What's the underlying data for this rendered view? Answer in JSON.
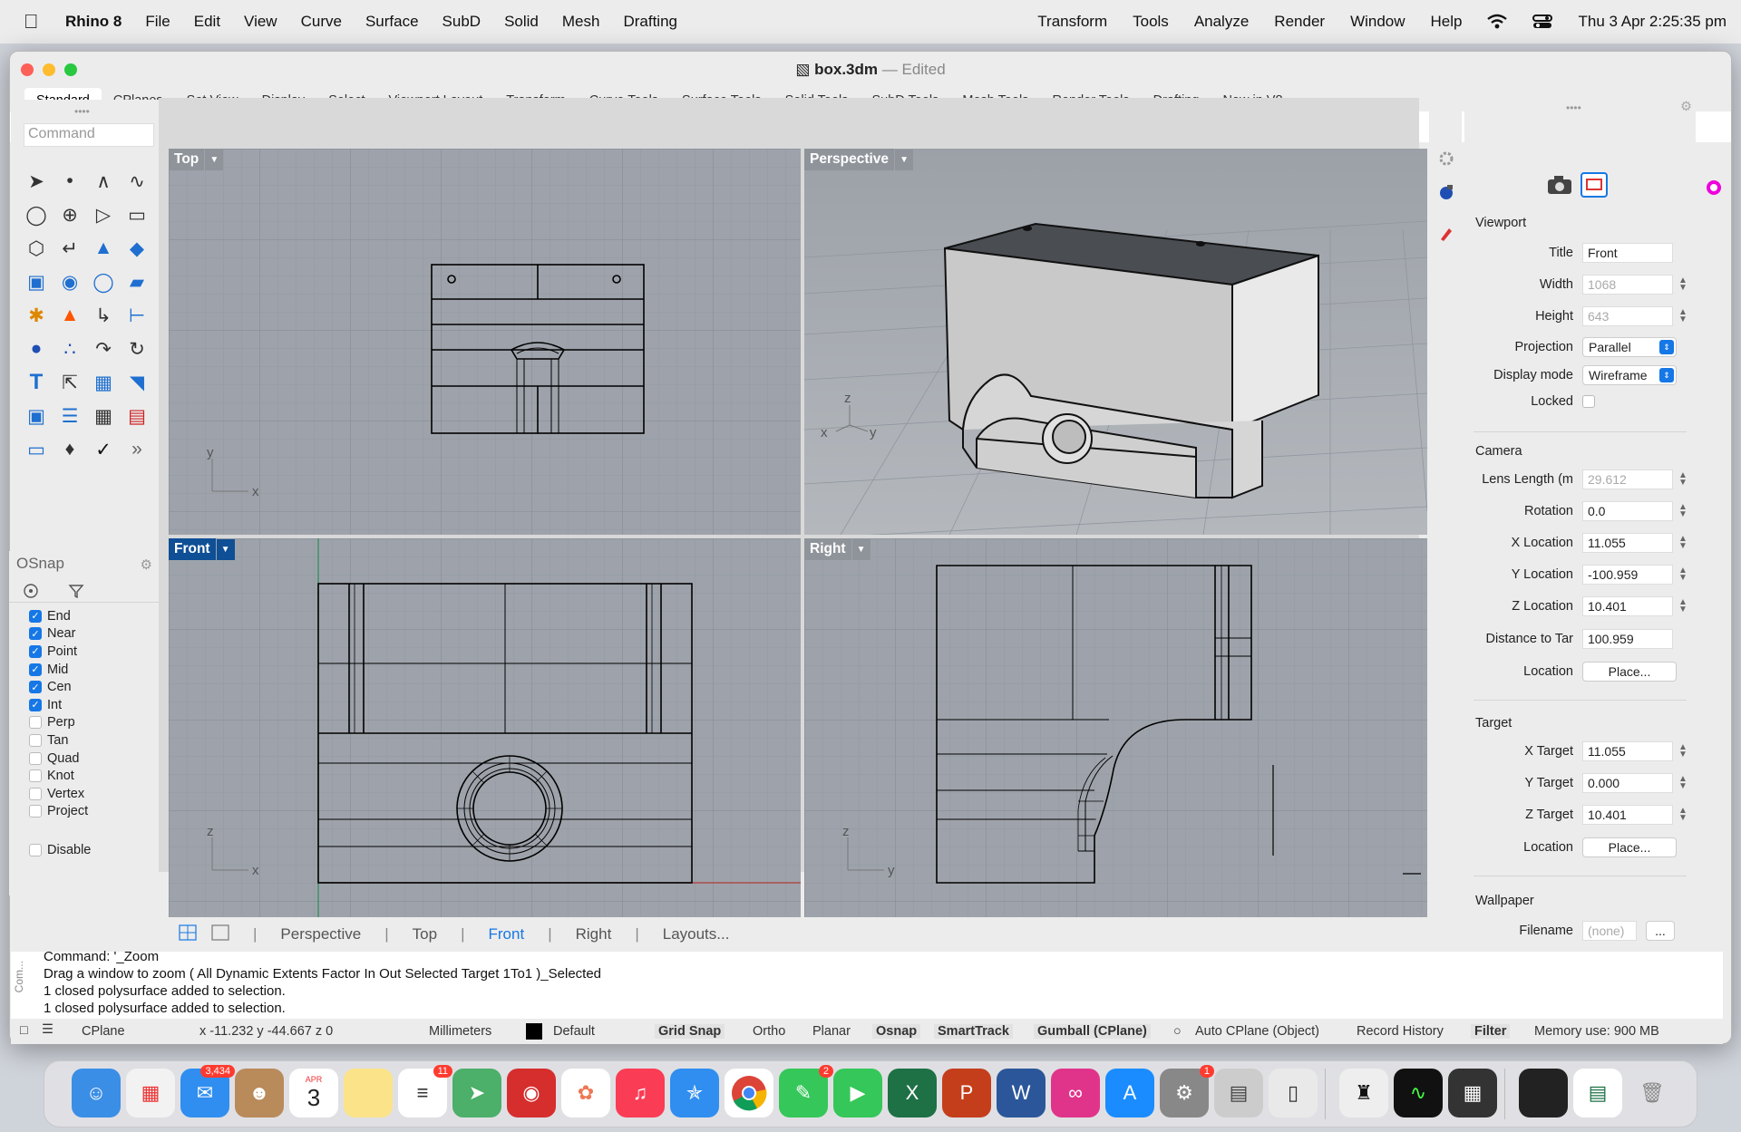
{
  "menubar": {
    "app": "Rhino 8",
    "items": [
      "File",
      "Edit",
      "View",
      "Curve",
      "Surface",
      "SubD",
      "Solid",
      "Mesh",
      "Drafting"
    ],
    "right_items": [
      "Transform",
      "Tools",
      "Analyze",
      "Render",
      "Window",
      "Help"
    ],
    "clock": "Thu 3 Apr  2:25:35 pm"
  },
  "window": {
    "filename": "box.3dm",
    "separator": "—",
    "status": "Edited"
  },
  "tabs": [
    "Standard",
    "CPlanes",
    "Set View",
    "Display",
    "Select",
    "Viewport Layout",
    "Transform",
    "Curve Tools",
    "Surface Tools",
    "Solid Tools",
    "SubD Tools",
    "Mesh Tools",
    "Render Tools",
    "Drafting",
    "New in V8"
  ],
  "toolbar_icons": [
    "new-file-icon",
    "open-file-icon",
    "save-icon",
    "print-icon",
    "import-icon",
    "cut-icon",
    "copy-icon",
    "paste-icon",
    "undo-icon",
    "pan-hand-icon",
    "rotate-view-icon",
    "zoom-icon",
    "zoom-window-icon",
    "zoom-extents-icon",
    "zoom-selected-icon",
    "rotate-icon",
    "four-viewports-icon",
    "car-icon",
    "grid-icon",
    "cplane-icon",
    "gumball-icon",
    "lightbulb-icon",
    "lock-icon",
    "layer-icon",
    "color-wheel-icon",
    "shaded-sphere-icon",
    "wireframe-sphere-icon",
    "render-sphere-icon",
    "pencil-icon",
    "gear-icon",
    "diagram-icon",
    "globe-icon",
    "help-icon"
  ],
  "command": {
    "placeholder": "Command"
  },
  "osnap": {
    "title": "OSnap",
    "items": [
      {
        "label": "End",
        "checked": true
      },
      {
        "label": "Near",
        "checked": true
      },
      {
        "label": "Point",
        "checked": true
      },
      {
        "label": "Mid",
        "checked": true
      },
      {
        "label": "Cen",
        "checked": true
      },
      {
        "label": "Int",
        "checked": true
      },
      {
        "label": "Perp",
        "checked": false
      },
      {
        "label": "Tan",
        "checked": false
      },
      {
        "label": "Quad",
        "checked": false
      },
      {
        "label": "Knot",
        "checked": false
      },
      {
        "label": "Vertex",
        "checked": false
      },
      {
        "label": "Project",
        "checked": false
      }
    ],
    "disable": "Disable"
  },
  "viewports": {
    "top": {
      "label": "Top",
      "axis_a": "y",
      "axis_b": "x"
    },
    "perspective": {
      "label": "Perspective",
      "axis_a": "z",
      "axis_b": "y",
      "axis_c": "x"
    },
    "front": {
      "label": "Front",
      "axis_a": "z",
      "axis_b": "x"
    },
    "right": {
      "label": "Right",
      "axis_a": "z",
      "axis_b": "y"
    }
  },
  "viewport_tabs": [
    "Perspective",
    "Top",
    "Front",
    "Right",
    "Layouts..."
  ],
  "properties": {
    "viewport_section": "Viewport",
    "title_label": "Title",
    "title": "Front",
    "width_label": "Width",
    "width": "1068",
    "height_label": "Height",
    "height": "643",
    "projection_label": "Projection",
    "projection": "Parallel",
    "display_label": "Display mode",
    "display": "Wireframe",
    "locked_label": "Locked",
    "camera_section": "Camera",
    "lens_label": "Lens Length (m",
    "lens": "29.612",
    "rotation_label": "Rotation",
    "rotation": "0.0",
    "xloc_label": "X Location",
    "xloc": "11.055",
    "yloc_label": "Y Location",
    "yloc": "-100.959",
    "zloc_label": "Z Location",
    "zloc": "10.401",
    "dist_label": "Distance to Tar",
    "dist": "100.959",
    "location_label": "Location",
    "place": "Place...",
    "target_section": "Target",
    "xt_label": "X Target",
    "xt": "11.055",
    "yt_label": "Y Target",
    "yt": "0.000",
    "zt_label": "Z Target",
    "zt": "10.401",
    "tloc_label": "Location",
    "tplace": "Place...",
    "wallpaper_section": "Wallpaper",
    "filename_label": "Filename",
    "filename": "(none)",
    "browse": "..."
  },
  "history": {
    "side": "Com...",
    "lines": [
      "Command: '_Zoom",
      "Drag a window to zoom ( All Dynamic Extents Factor In Out Selected Target 1To1 )_Selected",
      "1 closed polysurface added to selection.",
      "1 closed polysurface added to selection."
    ]
  },
  "status": {
    "cplane": "CPlane",
    "coords": "x -11.232  y -44.667  z 0",
    "units": "Millimeters",
    "layer": "Default",
    "grid_snap": "Grid Snap",
    "ortho": "Ortho",
    "planar": "Planar",
    "osnap": "Osnap",
    "smarttrack": "SmartTrack",
    "gumball": "Gumball (CPlane)",
    "autocplane": "Auto CPlane (Object)",
    "record": "Record History",
    "filter": "Filter",
    "memory": "Memory use: 900 MB"
  },
  "dock": {
    "mail_badge": "3,434",
    "calendar_month": "APR",
    "calendar_day": "3",
    "reminders_badge": "11",
    "messages_badge": "2",
    "settings_badge": "1"
  },
  "colors": {
    "accent": "#1677e6",
    "active_viewport": "#0f4f95",
    "viewport_bg": "#9ea3ab"
  }
}
